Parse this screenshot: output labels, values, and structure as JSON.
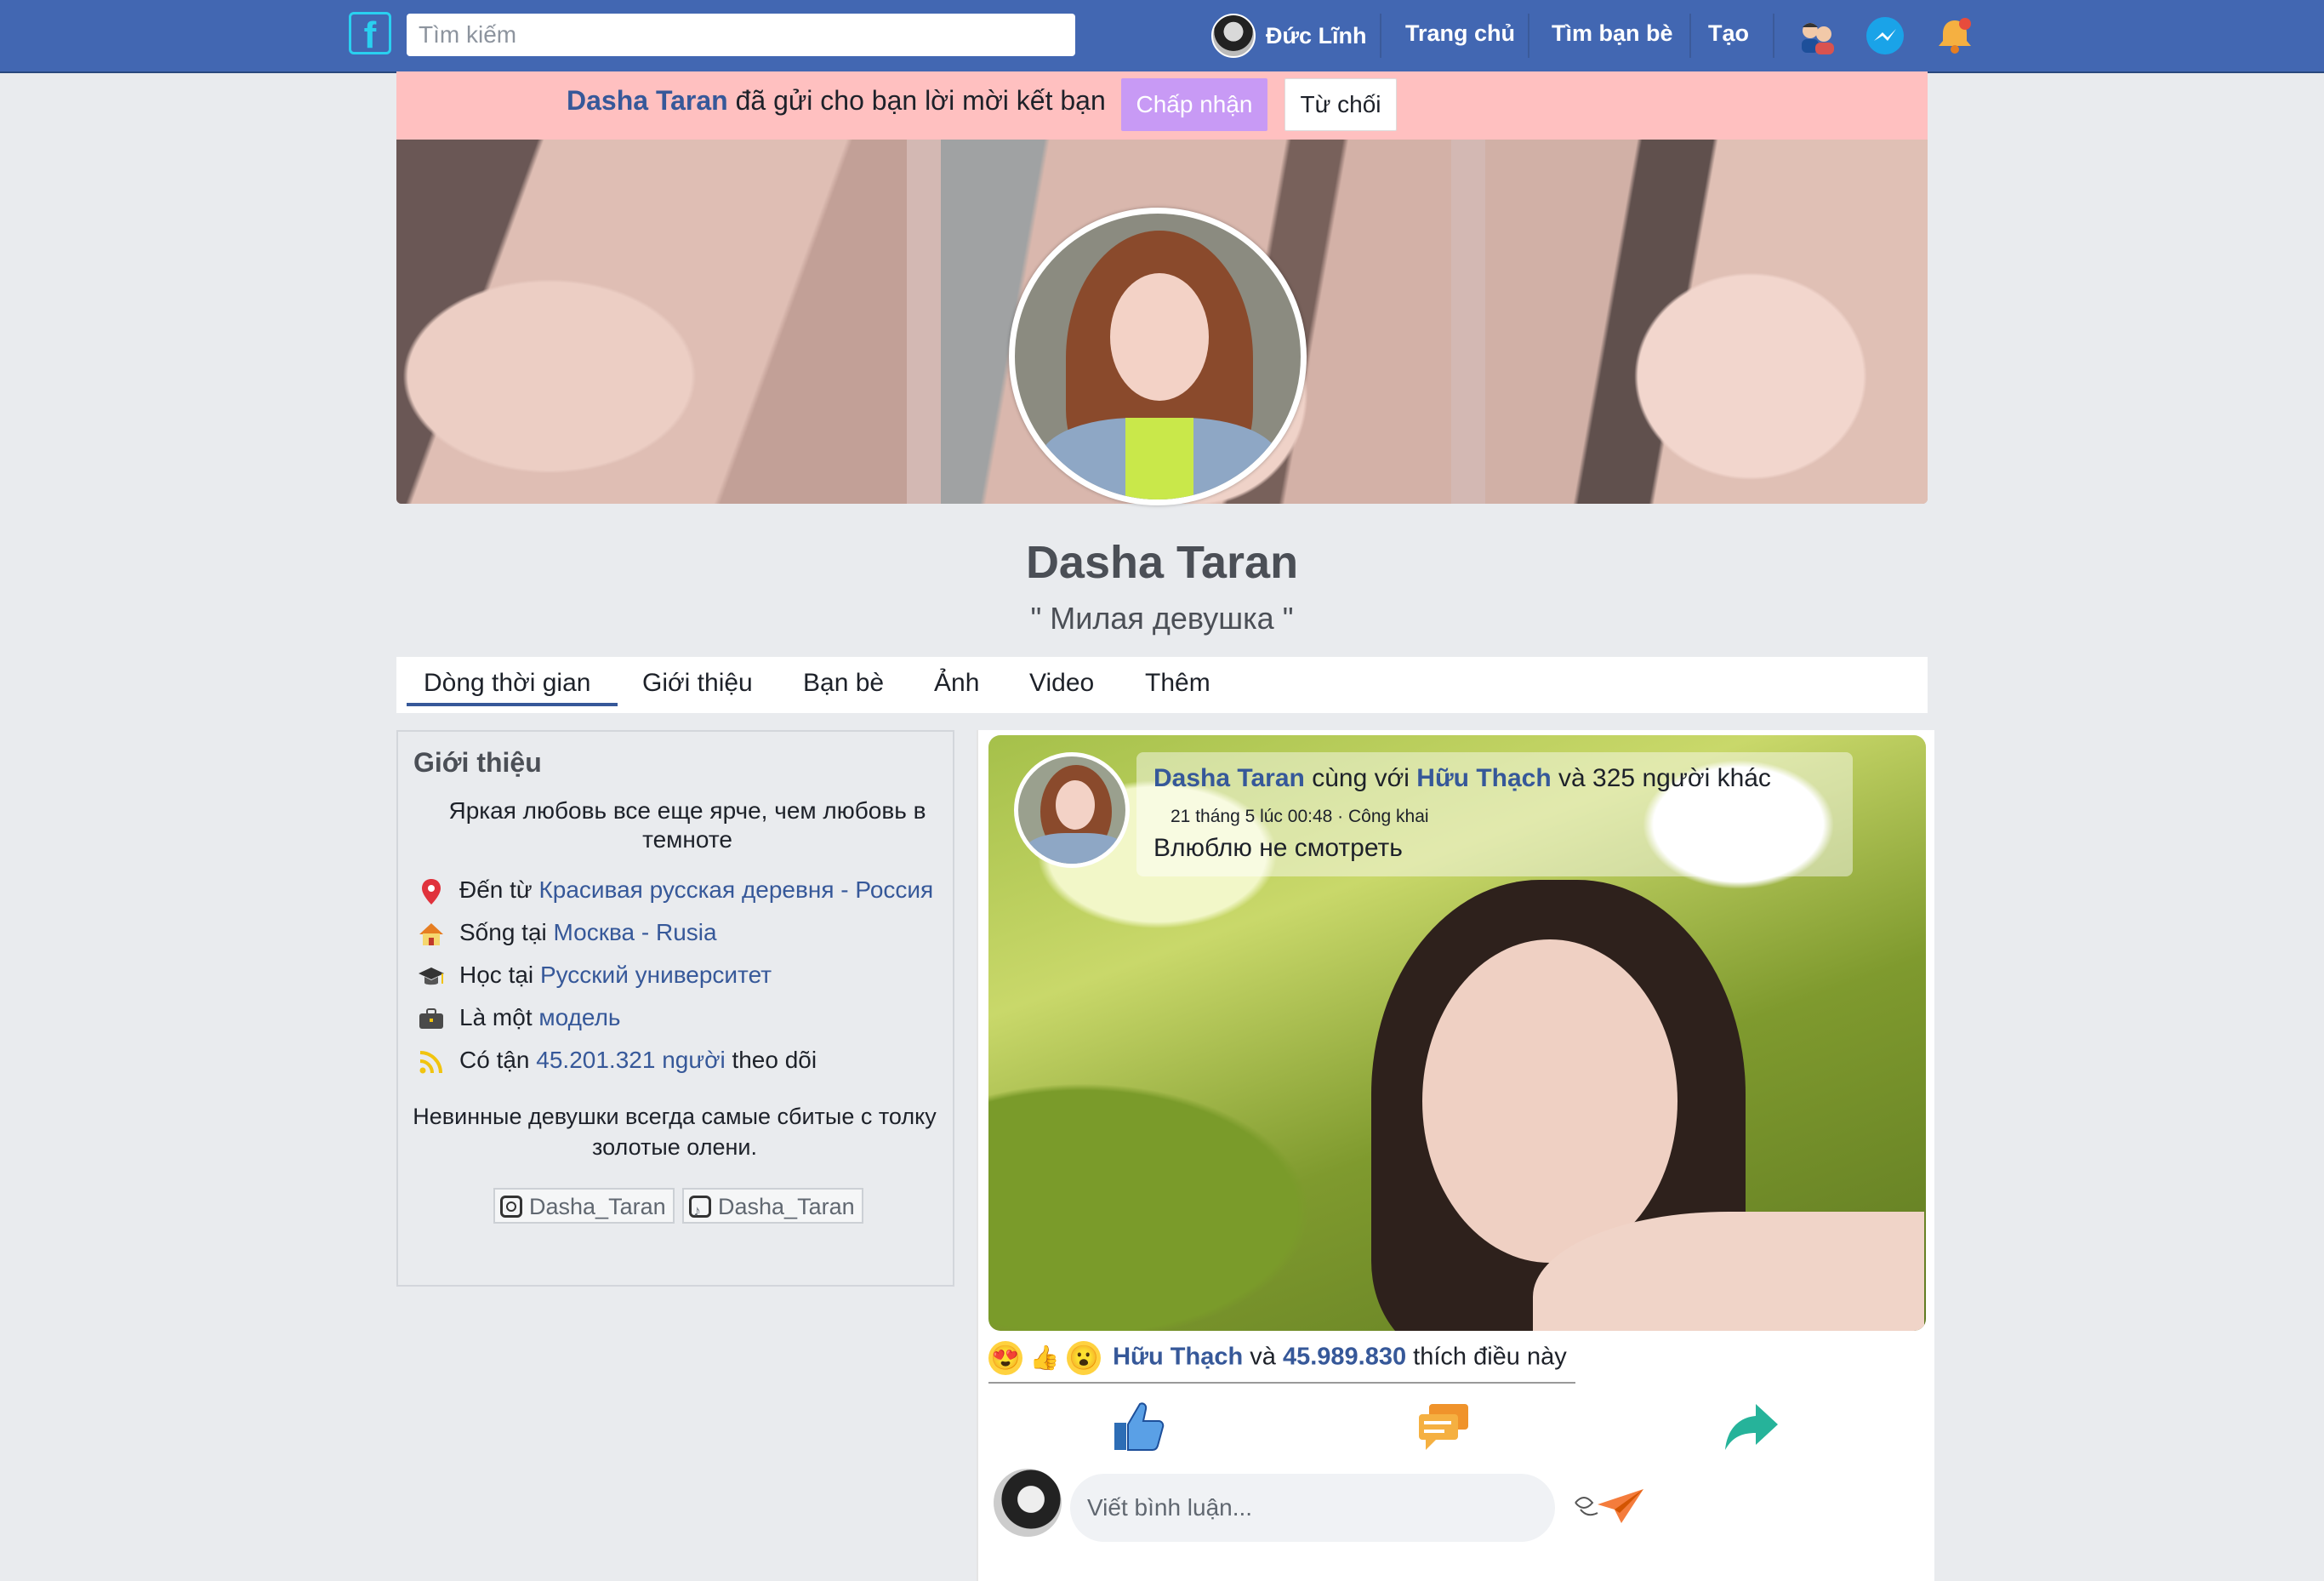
{
  "header": {
    "search_placeholder": "Tìm kiếm",
    "user_name": "Đức Lĩnh",
    "nav": [
      "Trang chủ",
      "Tìm bạn bè",
      "Tạo"
    ]
  },
  "friend_request": {
    "name": "Dasha Taran",
    "message": "đã gửi cho bạn lời mời kết bạn",
    "accept_label": "Chấp nhận",
    "decline_label": "Từ chối"
  },
  "profile": {
    "name": "Dasha Taran",
    "tagline": "\" Милая девушка \""
  },
  "tabs": [
    "Dòng thời gian",
    "Giới thiệu",
    "Bạn bè",
    "Ảnh",
    "Video",
    "Thêm"
  ],
  "intro": {
    "title": "Giới thiệu",
    "bio": "Яркая любовь все еще ярче, чем любовь в темноте",
    "rows": [
      {
        "icon": "location-pin-icon",
        "prefix": "Đến từ",
        "link": "Красивая русская деревня - Россия",
        "suffix": ""
      },
      {
        "icon": "home-icon",
        "prefix": "Sống tại",
        "link": "Москва - Rusia",
        "suffix": ""
      },
      {
        "icon": "graduation-cap-icon",
        "prefix": "Học tại",
        "link": "Русский университет",
        "suffix": ""
      },
      {
        "icon": "briefcase-icon",
        "prefix": "Là một",
        "link": "модель",
        "suffix": ""
      },
      {
        "icon": "rss-icon",
        "prefix": "Có tận",
        "link": "45.201.321 người",
        "suffix": "theo dõi"
      }
    ],
    "quote": "Невинные девушки всегда самые сбитые с толку золотые олени.",
    "social": [
      {
        "icon": "instagram-icon",
        "handle": "Dasha_Taran"
      },
      {
        "icon": "tiktok-icon",
        "handle": "Dasha_Taran"
      }
    ]
  },
  "post": {
    "author": "Dasha Taran",
    "with_text": "cùng với",
    "tagged": "Hữu Thạch",
    "others": "và 325 người khác",
    "meta": "21 tháng 5 lúc 00:48 · Công khai",
    "text": "Влюблю не смотреть",
    "reactions": {
      "name": "Hữu Thạch",
      "and": "và",
      "count": "45.989.830",
      "suffix": "thích điều này"
    },
    "comment_placeholder": "Viết bình luận..."
  },
  "colors": {
    "topbar": "#4267b2",
    "link": "#365899",
    "request_bg": "#ffc0c0",
    "accept_bg": "#c89af5"
  }
}
